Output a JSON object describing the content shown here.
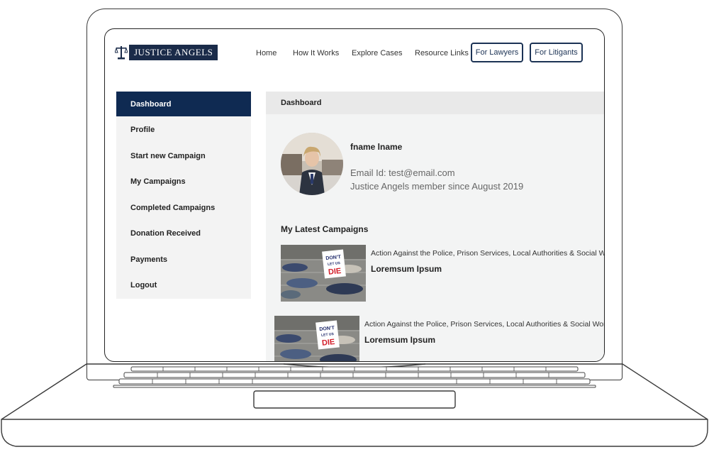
{
  "brand": {
    "name": "JUSTICE ANGELS"
  },
  "nav": {
    "links": [
      "Home",
      "How It Works",
      "Explore Cases",
      "Resource Links"
    ],
    "buttons": [
      "For Lawyers",
      "For Litigants"
    ]
  },
  "sidebar": {
    "items": [
      {
        "label": "Dashboard",
        "active": true
      },
      {
        "label": "Profile"
      },
      {
        "label": "Start new Campaign"
      },
      {
        "label": "My Campaigns"
      },
      {
        "label": "Completed Campaigns"
      },
      {
        "label": "Donation Received"
      },
      {
        "label": "Payments"
      },
      {
        "label": "Logout"
      }
    ]
  },
  "main": {
    "header": "Dashboard",
    "profile": {
      "name": "fname lname",
      "email_line": "Email Id: test@email.com",
      "member_line": "Justice Angels member since August 2019"
    },
    "latest_title": "My Latest Campaigns",
    "campaigns": [
      {
        "category": "Action Against the Police, Prison Services, Local Authorities & Social Workers",
        "title": "Loremsum Ipsum",
        "sign_text": "DON'T LET US DIE"
      },
      {
        "category": "Action Against the Police, Prison Services, Local Authorities & Social Workers",
        "title": "Loremsum Ipsum",
        "sign_text": "DON'T LET US DIE"
      }
    ]
  },
  "colors": {
    "navy": "#0f2a52",
    "button_border": "#1c3355",
    "sidebar_bg": "#f3f3f3",
    "main_bg": "#f3f4f4"
  },
  "icons": [
    "scales-of-justice-icon"
  ]
}
